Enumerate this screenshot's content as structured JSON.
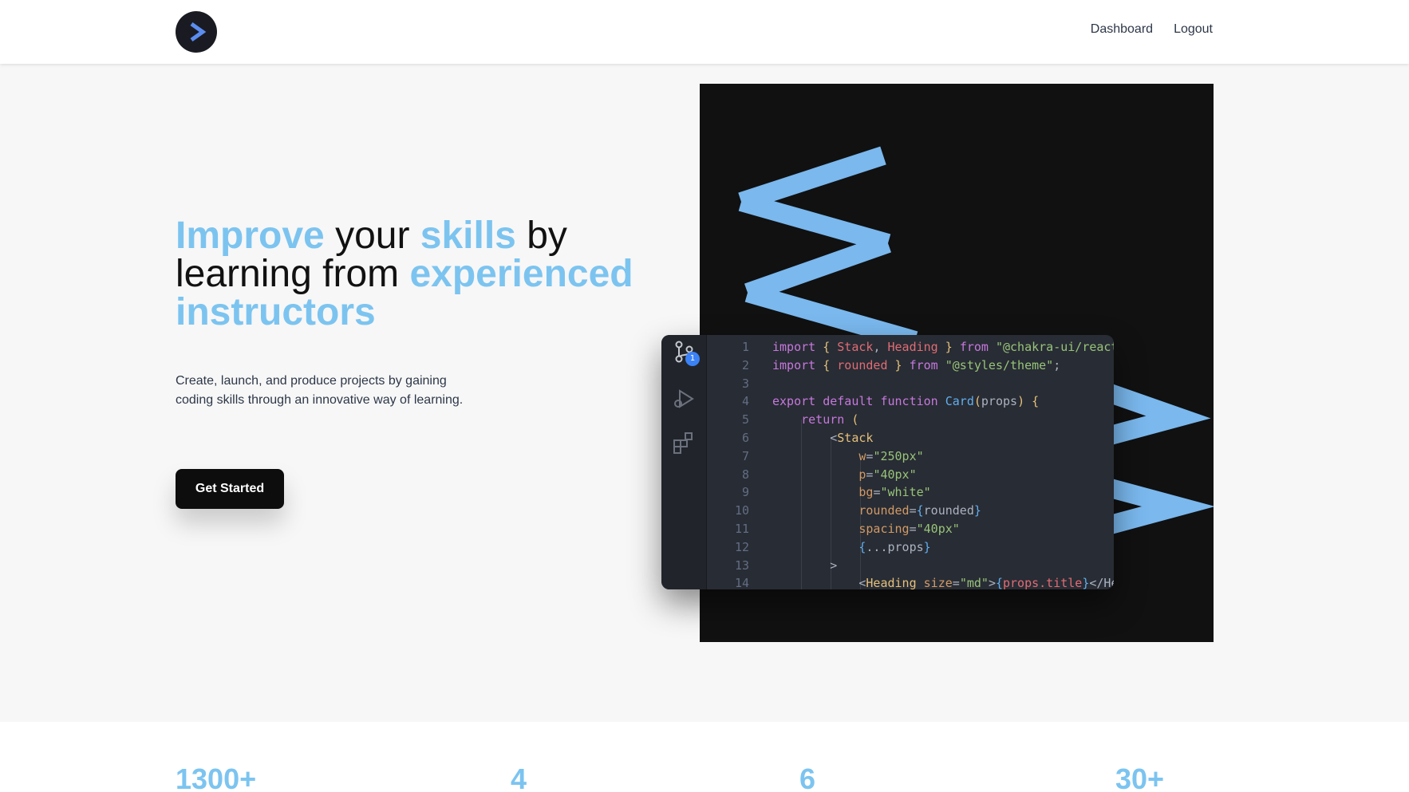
{
  "nav": {
    "logo_alt": "logo",
    "links": [
      "Dashboard",
      "Logout"
    ]
  },
  "hero": {
    "title_parts": [
      "Improve",
      " your ",
      "skills",
      " by",
      "learning from ",
      "experienced",
      "instructors"
    ],
    "description": "Create, launch, and produce projects by gaining coding skills through an innovative way of learning.",
    "cta_label": "Get Started"
  },
  "editor": {
    "scm_badge": "1",
    "line_numbers": [
      "1",
      "2",
      "3",
      "4",
      "5",
      "6",
      "7",
      "8",
      "9",
      "10",
      "11",
      "12",
      "13",
      "14"
    ]
  },
  "stats": [
    "1300+",
    "4",
    "6",
    "30+"
  ],
  "colors": {
    "accent": "#7cc4f0",
    "chevron": "#7ab8ee",
    "panel": "#111111",
    "editor_bg": "#282c34",
    "button": "#0d0d0d"
  }
}
